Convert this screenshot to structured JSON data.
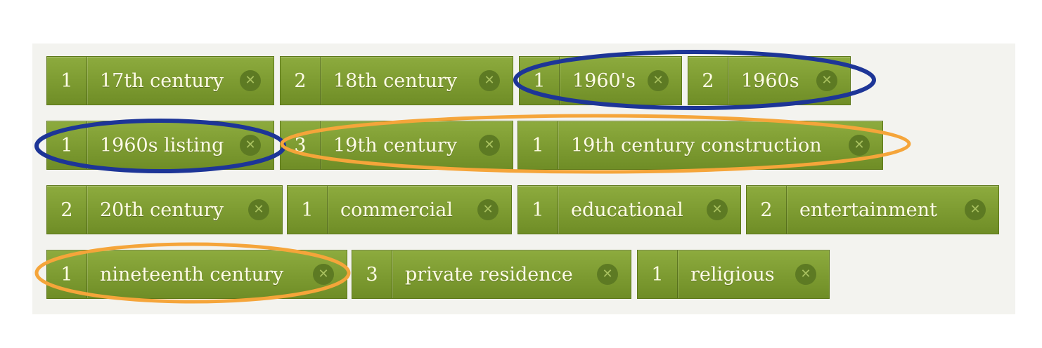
{
  "tags": [
    {
      "count": "1",
      "label": "17th century",
      "remove_icon": "x-circle-icon"
    },
    {
      "count": "2",
      "label": "18th century",
      "remove_icon": "x-circle-icon"
    },
    {
      "count": "1",
      "label": "1960's",
      "remove_icon": "x-circle-icon"
    },
    {
      "count": "2",
      "label": "1960s",
      "remove_icon": "x-circle-icon"
    },
    {
      "count": "1",
      "label": "1960s listing",
      "remove_icon": "x-circle-icon"
    },
    {
      "count": "3",
      "label": "19th century",
      "remove_icon": "x-circle-icon"
    },
    {
      "count": "1",
      "label": "19th century construction",
      "remove_icon": "x-circle-icon"
    },
    {
      "count": "2",
      "label": "20th century",
      "remove_icon": "x-circle-icon"
    },
    {
      "count": "1",
      "label": "commercial",
      "remove_icon": "x-circle-icon"
    },
    {
      "count": "1",
      "label": "educational",
      "remove_icon": "x-circle-icon"
    },
    {
      "count": "2",
      "label": "entertainment",
      "remove_icon": "x-circle-icon"
    },
    {
      "count": "1",
      "label": "nineteenth century",
      "remove_icon": "x-circle-icon"
    },
    {
      "count": "3",
      "label": "private residence",
      "remove_icon": "x-circle-icon"
    },
    {
      "count": "1",
      "label": "religious",
      "remove_icon": "x-circle-icon"
    }
  ],
  "remove_glyph": "✕",
  "annotation_colors": {
    "blue": "#1d3597",
    "orange": "#f5a53a"
  },
  "colors": {
    "tag_bg": "#7c9a30",
    "tag_text": "#fffce6",
    "panel_bg": "#f3f3ef"
  }
}
